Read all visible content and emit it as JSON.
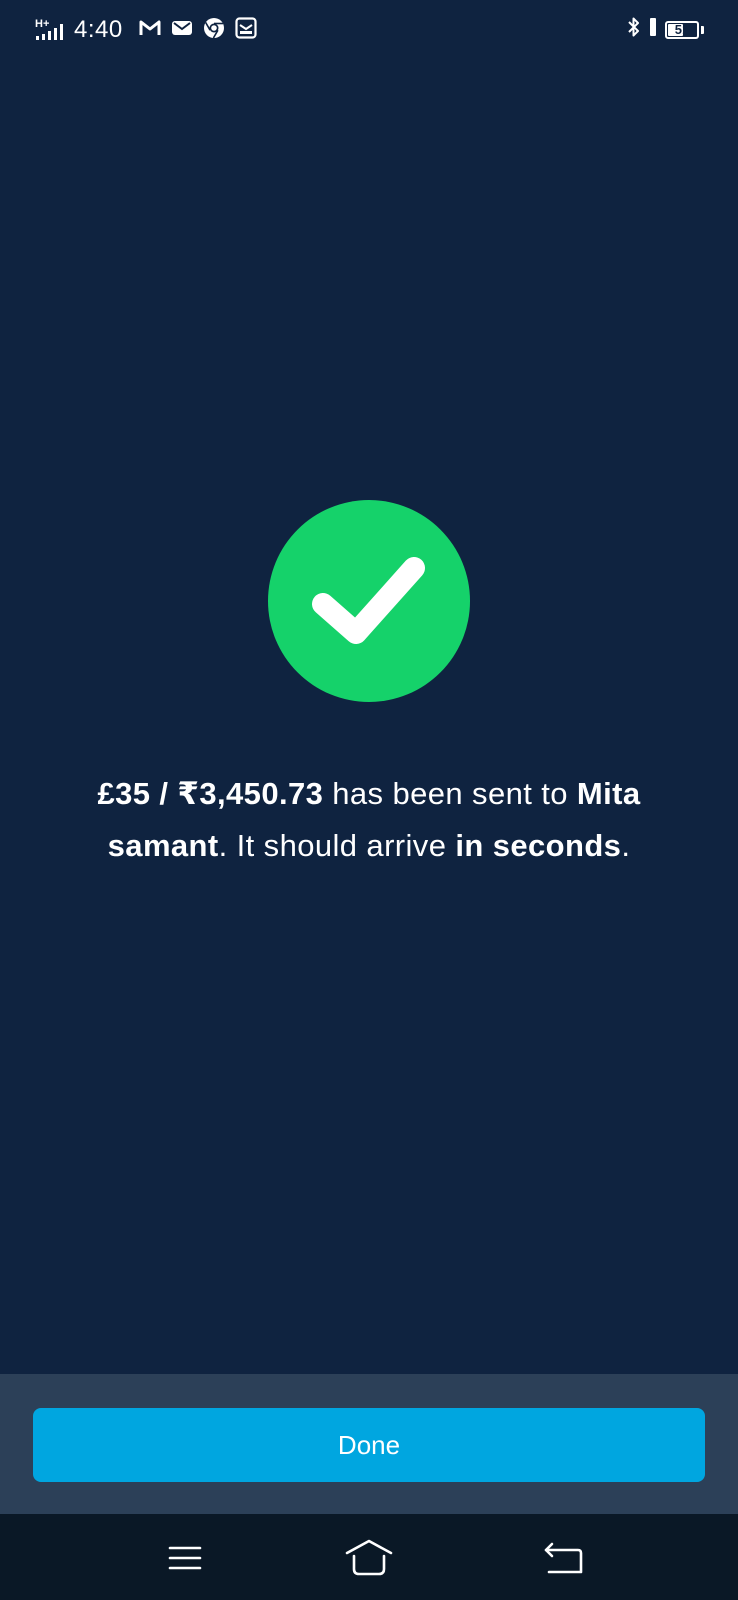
{
  "status_bar": {
    "network_type": "H+",
    "time": "4:40",
    "notification_icons": [
      "gmail-icon",
      "mail-icon",
      "chrome-icon",
      "message-icon"
    ],
    "bluetooth_icon": "bluetooth-icon",
    "vibrate_icon": "vibrate-icon",
    "battery_level": "51"
  },
  "success": {
    "icon": "check-icon",
    "color": "#15d26a"
  },
  "message": {
    "amount": "£35 / ₹3,450.73",
    "text_sent": " has been sent to ",
    "recipient": "Mita samant",
    "text_arrive": ". It should arrive ",
    "eta": "in seconds",
    "text_end": "."
  },
  "actions": {
    "done_label": "Done",
    "accent_color": "#00a6e0"
  },
  "nav_bar": {
    "icons": [
      "menu-icon",
      "home-icon",
      "back-icon"
    ]
  }
}
